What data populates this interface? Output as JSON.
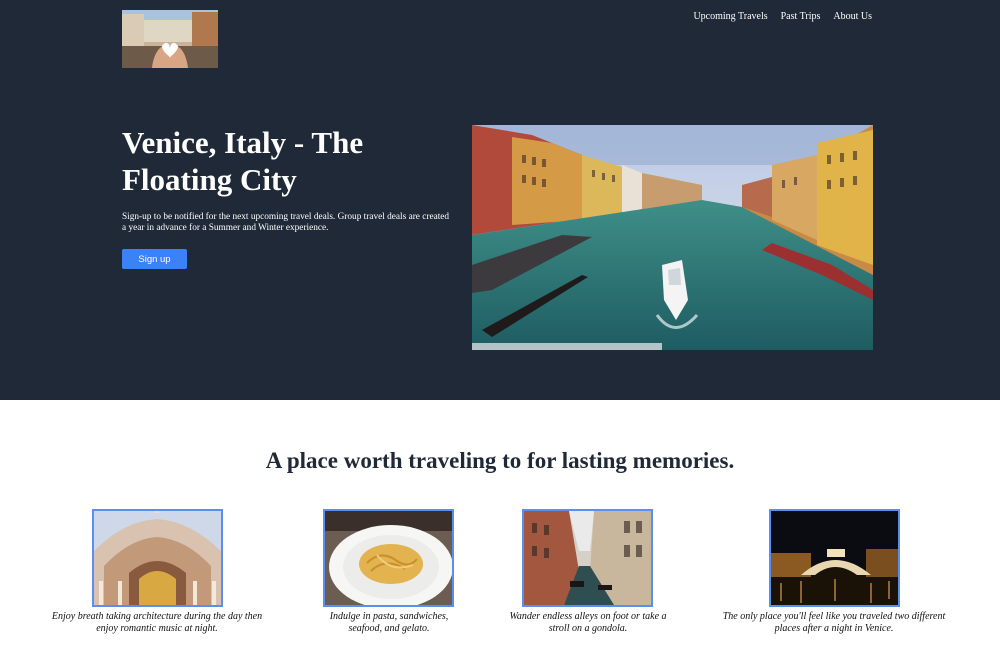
{
  "nav": {
    "items": [
      {
        "label": "Upcoming Travels"
      },
      {
        "label": "Past Trips"
      },
      {
        "label": "About Us"
      }
    ]
  },
  "hero": {
    "title": "Venice, Italy - The Floating City",
    "description": "Sign-up to be notified for the next upcoming travel deals. Group travel deals are created a year in advance for a Summer and Winter experience.",
    "button_label": "Sign up"
  },
  "section": {
    "title": "A place worth traveling to for lasting memories."
  },
  "features": [
    {
      "caption": "Enjoy breath taking architecture during the day then enjoy romantic music at night."
    },
    {
      "caption": "Indulge in pasta, sandwiches, seafood, and gelato."
    },
    {
      "caption": "Wander endless alleys on foot or take a stroll on a gondola."
    },
    {
      "caption": "The only place you'll feel like you traveled two different places after a night in Venice."
    }
  ],
  "colors": {
    "hero_background": "#1f2937",
    "accent": "#3b82f6",
    "image_border": "#5b8ef0"
  }
}
